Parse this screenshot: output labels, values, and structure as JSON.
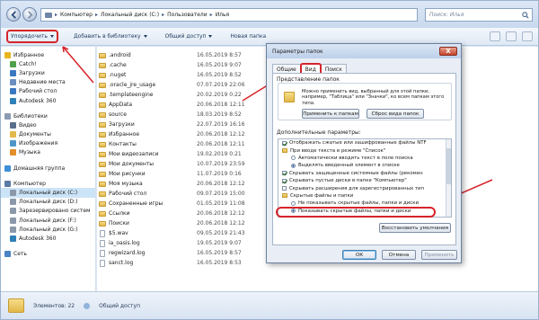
{
  "address": {
    "segments": [
      "Компьютер",
      "Локальный диск (C:)",
      "Пользователи",
      "Илья"
    ]
  },
  "search": {
    "placeholder": "Поиск: Илья"
  },
  "toolbar": {
    "organize": "Упорядочить",
    "library": "Добавить в библиотеку",
    "share": "Общий доступ",
    "newfolder": "Новая папка"
  },
  "nav": [
    {
      "label": "Избранное",
      "icon": "star-icon",
      "gap": false
    },
    {
      "label": "Catch!",
      "icon": "app-icon",
      "gap": false
    },
    {
      "label": "Загрузки",
      "icon": "download-icon",
      "gap": false
    },
    {
      "label": "Недавние места",
      "icon": "recent-icon",
      "gap": false
    },
    {
      "label": "Рабочий стол",
      "icon": "desktop-icon",
      "gap": false
    },
    {
      "label": "Autodesk 360",
      "icon": "cloud-icon",
      "gap": false
    },
    {
      "label": "Библиотеки",
      "icon": "library-icon",
      "gap": true
    },
    {
      "label": "Видео",
      "icon": "video-icon",
      "gap": false
    },
    {
      "label": "Документы",
      "icon": "documents-icon",
      "gap": false
    },
    {
      "label": "Изображения",
      "icon": "images-icon",
      "gap": false
    },
    {
      "label": "Музыка",
      "icon": "music-icon",
      "gap": false
    },
    {
      "label": "Домашняя группа",
      "icon": "homegroup-icon",
      "gap": true
    },
    {
      "label": "Компьютер",
      "icon": "computer-icon",
      "gap": true
    },
    {
      "label": "Локальный диск (C:)",
      "icon": "drive-icon",
      "gap": false,
      "selected": true
    },
    {
      "label": "Локальный диск (D:)",
      "icon": "drive-icon",
      "gap": false
    },
    {
      "label": "Зарезервировано систем",
      "icon": "drive-icon",
      "gap": false
    },
    {
      "label": "Локальный диск (F:)",
      "icon": "drive-icon",
      "gap": false
    },
    {
      "label": "Локальный диск (G:)",
      "icon": "drive-icon",
      "gap": false
    },
    {
      "label": "Autodesk 360",
      "icon": "cloud-icon",
      "gap": false
    },
    {
      "label": "Сеть",
      "icon": "network-icon",
      "gap": true
    }
  ],
  "files": [
    {
      "name": ".android",
      "date": "16.05.2019 8:57",
      "type": "folder"
    },
    {
      "name": ".cache",
      "date": "16.05.2019 9:07",
      "type": "folder"
    },
    {
      "name": ".nuget",
      "date": "16.05.2019 8:52",
      "type": "folder"
    },
    {
      "name": ".oracle_jre_usage",
      "date": "07.07.2019 22:06",
      "type": "folder"
    },
    {
      "name": ".templateengine",
      "date": "20.02.2019 0:22",
      "type": "folder"
    },
    {
      "name": "AppData",
      "date": "20.06.2018 12:11",
      "type": "folder"
    },
    {
      "name": "source",
      "date": "18.03.2019 8:52",
      "type": "folder"
    },
    {
      "name": "Загрузки",
      "date": "22.07.2019 16:16",
      "type": "folder"
    },
    {
      "name": "Избранное",
      "date": "20.06.2018 12:12",
      "type": "folder"
    },
    {
      "name": "Контакты",
      "date": "20.06.2018 12:11",
      "type": "folder"
    },
    {
      "name": "Мои видеозаписи",
      "date": "19.02.2019 0:21",
      "type": "folder"
    },
    {
      "name": "Мои документы",
      "date": "10.07.2019 23:59",
      "type": "folder"
    },
    {
      "name": "Мои рисунки",
      "date": "11.07.2019 0:16",
      "type": "folder"
    },
    {
      "name": "Моя музыка",
      "date": "20.06.2018 12:12",
      "type": "folder"
    },
    {
      "name": "Рабочий стол",
      "date": "09.07.2019 15:00",
      "type": "folder"
    },
    {
      "name": "Сохраненные игры",
      "date": "01.05.2019 11:08",
      "type": "folder"
    },
    {
      "name": "Ссылки",
      "date": "20.06.2018 12:12",
      "type": "folder"
    },
    {
      "name": "Поиски",
      "date": "20.06.2018 12:12",
      "type": "folder"
    },
    {
      "name": "$5.wav",
      "date": "09.05.2019 21:43",
      "type": "file"
    },
    {
      "name": "ia_oasis.log",
      "date": "19.05.2019 9:07",
      "type": "file"
    },
    {
      "name": "regwizard.log",
      "date": "16.05.2019 8:57",
      "type": "file"
    },
    {
      "name": "sanct.log",
      "date": "16.05.2019 8:53",
      "type": "file"
    }
  ],
  "status": {
    "count": "Элементов: 22",
    "share": "Общий доступ"
  },
  "dialog": {
    "title": "Параметры папок",
    "close": "X",
    "tabs": [
      "Общие",
      "Вид",
      "Поиск"
    ],
    "folder_view_group": "Представление папок",
    "folder_view_text": "Можно применить вид, выбранный для этой папки, например, \"Таблица\" или \"Значки\", ко всем папкам этого типа.",
    "apply_button": "Применить к папкам",
    "reset_button": "Сброс вида папок",
    "advanced_label": "Дополнительные параметры:",
    "tree": [
      {
        "kind": "cb",
        "on": true,
        "indent": 1,
        "label": "Отображать сжатые или зашифрованные файлы NTF"
      },
      {
        "kind": "folder",
        "on": false,
        "indent": 1,
        "label": "При вводе текста в режиме \"Список\""
      },
      {
        "kind": "rb",
        "on": false,
        "indent": 2,
        "label": "Автоматически вводить текст в поле поиска"
      },
      {
        "kind": "rb",
        "on": true,
        "indent": 2,
        "label": "Выделять введенный элемент в списке"
      },
      {
        "kind": "cb",
        "on": true,
        "indent": 1,
        "label": "Скрывать защищенные системные файлы (рекомен"
      },
      {
        "kind": "cb",
        "on": true,
        "indent": 1,
        "label": "Скрывать пустые диски в папке \"Компьютер\""
      },
      {
        "kind": "cb",
        "on": false,
        "indent": 1,
        "label": "Скрывать расширения для зарегистрированных тип"
      },
      {
        "kind": "folder",
        "on": false,
        "indent": 1,
        "label": "Скрытые файлы и папки"
      },
      {
        "kind": "rb",
        "on": false,
        "indent": 2,
        "label": "Не показывать скрытые файлы, папки и диски"
      },
      {
        "kind": "rb",
        "on": true,
        "indent": 2,
        "label": "Показывать скрытые файлы, папки и диски"
      }
    ],
    "restore_button": "Восстановить умолчания",
    "ok": "ОК",
    "cancel": "Отмена",
    "apply": "Применить"
  },
  "colors": {
    "highlight": "#d6242b",
    "accent": "#1e395b"
  }
}
